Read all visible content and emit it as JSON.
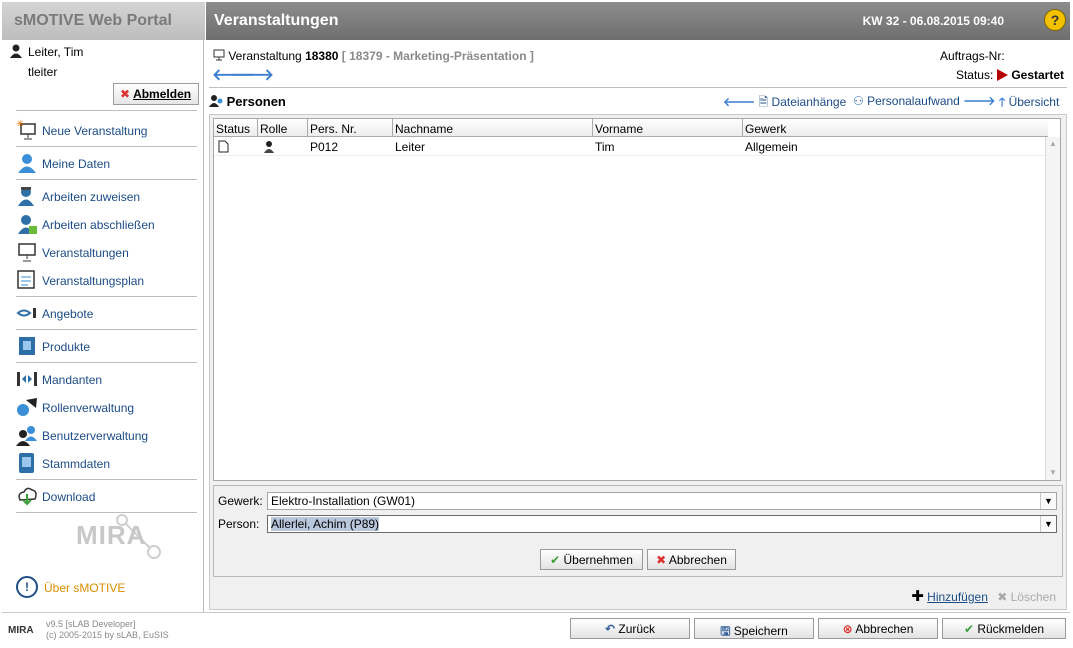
{
  "app": {
    "brand": "sMOTIVE Web Portal",
    "page_title": "Veranstaltungen",
    "week_date": "KW 32 - 06.08.2015 09:40",
    "help": "?"
  },
  "user": {
    "name": "Leiter, Tim",
    "login": "tleiter",
    "logout_label": "Abmelden"
  },
  "nav": [
    {
      "label": "Neue Veranstaltung",
      "icon": "new-event-icon"
    },
    {
      "label": "Meine Daten",
      "icon": "my-data-icon"
    },
    {
      "label": "Arbeiten zuweisen",
      "icon": "assign-work-icon"
    },
    {
      "label": "Arbeiten abschließen",
      "icon": "finish-work-icon"
    },
    {
      "label": "Veranstaltungen",
      "icon": "events-icon"
    },
    {
      "label": "Veranstaltungsplan",
      "icon": "event-plan-icon"
    },
    {
      "label": "Angebote",
      "icon": "offers-icon"
    },
    {
      "label": "Produkte",
      "icon": "products-icon"
    },
    {
      "label": "Mandanten",
      "icon": "clients-icon"
    },
    {
      "label": "Rollenverwaltung",
      "icon": "roles-icon"
    },
    {
      "label": "Benutzerverwaltung",
      "icon": "users-icon"
    },
    {
      "label": "Stammdaten",
      "icon": "master-data-icon"
    },
    {
      "label": "Download",
      "icon": "download-icon"
    }
  ],
  "sidebar_logo": "MIRA",
  "about_label": "Über sMOTIVE",
  "event": {
    "label": "Veranstaltung",
    "number": "18380",
    "ref": "[ 18379 - Marketing-Präsentation ]"
  },
  "order": {
    "label": "Auftrags-Nr:",
    "status_label": "Status:",
    "status_value": "Gestartet"
  },
  "section": {
    "title": "Personen"
  },
  "toplinks": {
    "files": "Dateianhänge",
    "staff": "Personalaufwand",
    "overview": "Übersicht"
  },
  "table": {
    "columns": [
      "Status",
      "Rolle",
      "Pers. Nr.",
      "Nachname",
      "Vorname",
      "Gewerk"
    ],
    "rows": [
      {
        "pers_nr": "P012",
        "nachname": "Leiter",
        "vorname": "Tim",
        "gewerk": "Allgemein"
      }
    ]
  },
  "form": {
    "gewerk_label": "Gewerk:",
    "gewerk_value": "Elektro-Installation (GW01)",
    "person_label": "Person:",
    "person_value": "Allerlei, Achim (P89)",
    "apply": "Übernehmen",
    "cancel": "Abbrechen"
  },
  "actions": {
    "add": "Hinzufügen",
    "delete": "Löschen"
  },
  "footer": {
    "version": "v9.5 [sLAB Developer]",
    "copyright": "(c) 2005-2015 by sLAB, EuSIS",
    "logo": "MIRA",
    "back": "Zurück",
    "save": "Speichern",
    "abort": "Abbrechen",
    "report": "Rückmelden"
  },
  "colors": {
    "link": "#1c4c86",
    "accent_arrow": "#3c7fd0",
    "status_red": "#b60000",
    "about": "#d98e00"
  }
}
